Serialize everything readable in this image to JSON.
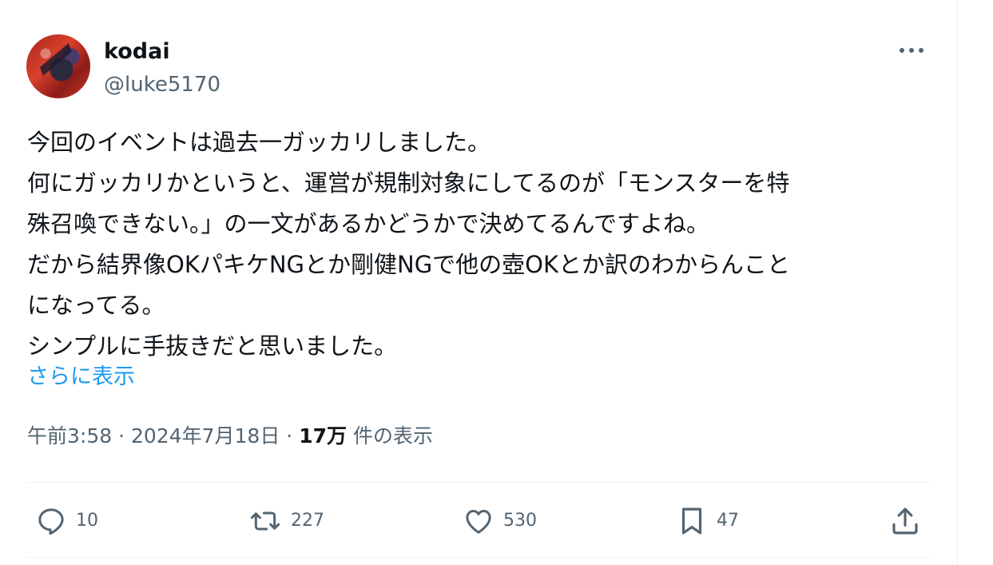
{
  "author": {
    "display_name": "kodai",
    "handle": "@luke5170"
  },
  "tweet": {
    "lines": [
      "今回のイベントは過去一ガッカリしました。",
      "何にガッカリかというと、運営が規制対象にしてるのが「モンスターを特",
      "殊召喚できない。」の一文があるかどうかで決めてるんですよね。",
      "だから結界像OKパキケNGとか剛健NGで他の壺OKとか訳のわからんこと",
      "になってる。",
      "シンプルに手抜きだと思いました。"
    ],
    "show_more": "さらに表示"
  },
  "meta": {
    "time": "午前3:58",
    "separator": "·",
    "date": "2024年7月18日",
    "views_count": "17万",
    "views_label": "件の表示"
  },
  "actions": {
    "replies": "10",
    "retweets": "227",
    "likes": "530",
    "bookmarks": "47"
  },
  "colors": {
    "text": "#0f1419",
    "secondary": "#536471",
    "link": "#1d9bf0",
    "divider": "#eff3f4"
  },
  "icons": [
    "more-icon",
    "reply-icon",
    "retweet-icon",
    "like-icon",
    "bookmark-icon",
    "share-icon"
  ]
}
